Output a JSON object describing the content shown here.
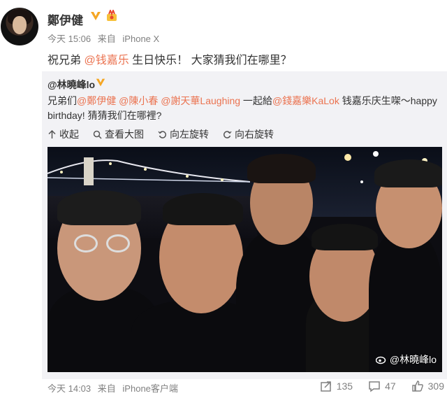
{
  "post": {
    "author": "鄭伊健",
    "meta": {
      "time": "今天 15:06",
      "source_prefix": "来自",
      "source": "iPhone X"
    },
    "text": {
      "prefix": "祝兄弟 ",
      "mention": "@钱嘉乐",
      "suffix": " 生日快乐！ 大家猜我们在哪里？"
    }
  },
  "repost": {
    "author": "@林曉峰lo",
    "text": {
      "p1": "兄弟们",
      "m1": "@鄭伊健",
      "m2": "@陳小春",
      "m3": "@謝天華Laughing",
      "p2": " 一起給",
      "m4": "@錢嘉樂KaLok",
      "p3": " 钱嘉乐庆生㗎～happy birthday! 猜猜我们在哪裡?"
    },
    "toolbar": {
      "collapse": "收起",
      "view_large": "查看大图",
      "rotate_left": "向左旋转",
      "rotate_right": "向右旋转"
    },
    "watermark": "@林曉峰lo"
  },
  "footer": {
    "time": "今天 14:03",
    "source_prefix": "来自",
    "source": "iPhone客户端",
    "repost_count": "135",
    "comment_count": "47",
    "like_count": "309"
  },
  "colors": {
    "mention": "#eb7350",
    "verified": "#f5a623",
    "meta": "#808080",
    "repost_bg": "#f2f2f5"
  }
}
